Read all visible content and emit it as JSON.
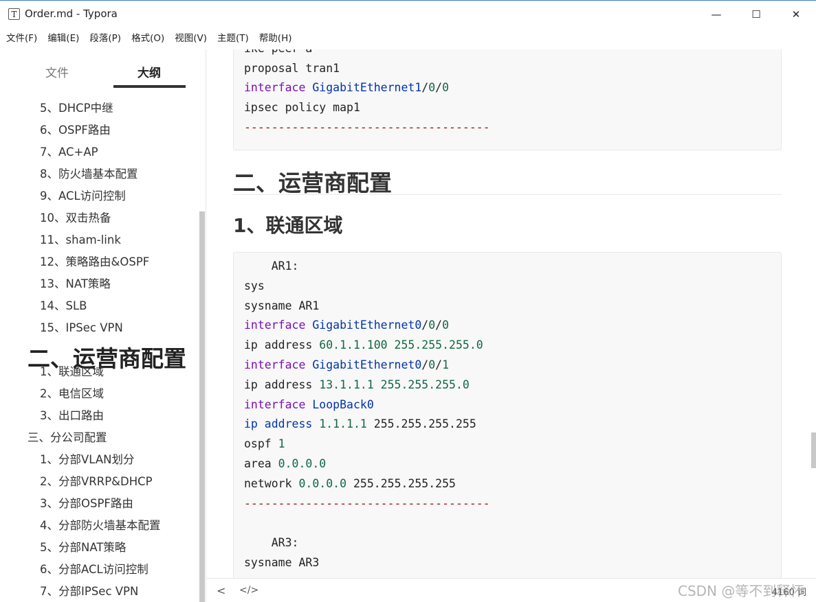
{
  "window": {
    "icon_letter": "T",
    "title": "Order.md - Typora",
    "minimize": "—",
    "maximize": "☐",
    "close": "✕"
  },
  "menu": [
    "文件(F)",
    "编辑(E)",
    "段落(P)",
    "格式(O)",
    "视图(V)",
    "主题(T)",
    "帮助(H)"
  ],
  "sidebar": {
    "tabs": [
      {
        "label": "文件",
        "active": false
      },
      {
        "label": "大纲",
        "active": true
      }
    ],
    "outline": [
      {
        "label": "5、DHCP中继",
        "level": 2
      },
      {
        "label": "6、OSPF路由",
        "level": 2
      },
      {
        "label": "7、AC+AP",
        "level": 2
      },
      {
        "label": "8、防火墙基本配置",
        "level": 2
      },
      {
        "label": "9、ACL访问控制",
        "level": 2
      },
      {
        "label": "10、双击热备",
        "level": 2
      },
      {
        "label": "11、sham-link",
        "level": 2
      },
      {
        "label": "12、策略路由&OSPF",
        "level": 2
      },
      {
        "label": "13、NAT策略",
        "level": 2
      },
      {
        "label": "14、SLB",
        "level": 2
      },
      {
        "label": "15、IPSec VPN",
        "level": 2
      },
      {
        "label": "二、运营商配置",
        "level": 1,
        "active": true
      },
      {
        "label": "1、联通区域",
        "level": 2
      },
      {
        "label": "2、电信区域",
        "level": 2
      },
      {
        "label": "3、出口路由",
        "level": 2
      },
      {
        "label": "三、分公司配置",
        "level": 1
      },
      {
        "label": "1、分部VLAN划分",
        "level": 2
      },
      {
        "label": "2、分部VRRP&DHCP",
        "level": 2
      },
      {
        "label": "3、分部OSPF路由",
        "level": 2
      },
      {
        "label": "4、分部防火墙基本配置",
        "level": 2
      },
      {
        "label": "5、分部NAT策略",
        "level": 2
      },
      {
        "label": "6、分部ACL访问控制",
        "level": 2
      },
      {
        "label": "7、分部IPSec VPN",
        "level": 2
      }
    ]
  },
  "editor": {
    "code1": [
      {
        "t": "plain",
        "parts": [
          [
            "",
            "ike-peer a"
          ]
        ]
      },
      {
        "t": "plain",
        "parts": [
          [
            "",
            "proposal tran1"
          ]
        ]
      },
      {
        "t": "mix",
        "parts": [
          [
            "kw",
            "interface "
          ],
          [
            "attr",
            "GigabitEthernet1"
          ],
          [
            "",
            "/"
          ],
          [
            "num",
            "0"
          ],
          [
            "",
            "/"
          ],
          [
            "num",
            "0"
          ]
        ]
      },
      {
        "t": "plain",
        "parts": [
          [
            "",
            "ipsec policy map1"
          ]
        ]
      },
      {
        "t": "sep",
        "parts": [
          [
            "sep",
            "------------------------------------"
          ]
        ]
      }
    ],
    "heading1": "二、运营商配置",
    "heading2": "1、联通区域",
    "code2": [
      {
        "parts": [
          [
            "",
            "    AR1:"
          ]
        ]
      },
      {
        "parts": [
          [
            "",
            "sys"
          ]
        ]
      },
      {
        "parts": [
          [
            "",
            "sysname AR1"
          ]
        ]
      },
      {
        "parts": [
          [
            "kw",
            "interface "
          ],
          [
            "attr",
            "GigabitEthernet0"
          ],
          [
            "",
            "/"
          ],
          [
            "num",
            "0"
          ],
          [
            "",
            "/"
          ],
          [
            "num",
            "0"
          ]
        ]
      },
      {
        "parts": [
          [
            "",
            "ip address "
          ],
          [
            "num",
            "60.1.1.100 255.255.255.0"
          ]
        ]
      },
      {
        "parts": [
          [
            "kw",
            "interface "
          ],
          [
            "attr",
            "GigabitEthernet0"
          ],
          [
            "",
            "/"
          ],
          [
            "num",
            "0"
          ],
          [
            "",
            "/"
          ],
          [
            "num",
            "1"
          ]
        ]
      },
      {
        "parts": [
          [
            "",
            "ip address "
          ],
          [
            "num",
            "13.1.1.1 255.255.255.0"
          ]
        ]
      },
      {
        "parts": [
          [
            "kw",
            "interface "
          ],
          [
            "attr",
            "LoopBack0"
          ]
        ]
      },
      {
        "parts": [
          [
            "attr",
            "ip address "
          ],
          [
            "num",
            "1.1.1.1 "
          ],
          [
            "",
            "255.255.255.255"
          ]
        ]
      },
      {
        "parts": [
          [
            "",
            "ospf "
          ],
          [
            "num",
            "1"
          ]
        ]
      },
      {
        "parts": [
          [
            "",
            "area "
          ],
          [
            "num",
            "0.0.0.0"
          ]
        ]
      },
      {
        "parts": [
          [
            "",
            "network "
          ],
          [
            "num",
            "0.0.0.0 "
          ],
          [
            "",
            "255.255.255.255"
          ]
        ]
      },
      {
        "parts": [
          [
            "sep",
            "------------------------------------"
          ]
        ]
      },
      {
        "parts": [
          [
            "",
            ""
          ]
        ]
      },
      {
        "parts": [
          [
            "",
            "    AR3:"
          ]
        ]
      },
      {
        "parts": [
          [
            "",
            "sysname AR3"
          ]
        ]
      }
    ]
  },
  "footer": {
    "back_icon": "<",
    "source_icon": "</>",
    "word_count": "4160 词"
  },
  "watermark": "CSDN @等不到释怀",
  "colors": {
    "keyword": "#7a0fb5",
    "attribute": "#0033a8",
    "number": "#116644",
    "separator": "#a31515"
  }
}
